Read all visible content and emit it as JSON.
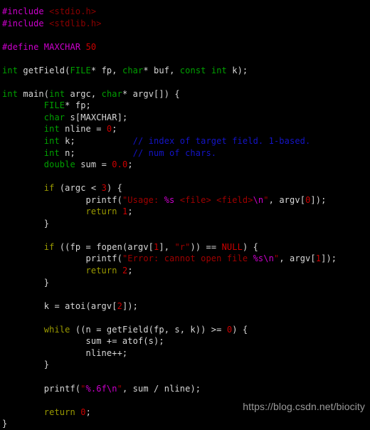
{
  "editor": {
    "background_color": "#000000",
    "language": "C",
    "colors": {
      "plain": "#d8d8d8",
      "keyword_type": "#00a000",
      "keyword_control": "#9a9a00",
      "preprocessor": "#cc00cc",
      "include_header": "#8b0000",
      "string": "#a00000",
      "format_specifier": "#cc00cc",
      "number": "#cc0000",
      "constant": "#cc0000",
      "comment": "#1414c8"
    }
  },
  "code": {
    "lines": [
      {
        "id": "line-1",
        "text": "#include <stdio.h>"
      },
      {
        "id": "line-2",
        "text": "#include <stdlib.h>"
      },
      {
        "id": "line-3",
        "text": ""
      },
      {
        "id": "line-4",
        "text": "#define MAXCHAR 50"
      },
      {
        "id": "line-5",
        "text": ""
      },
      {
        "id": "line-6",
        "text": "int getField(FILE* fp, char* buf, const int k);"
      },
      {
        "id": "line-7",
        "text": ""
      },
      {
        "id": "line-8",
        "text": "int main(int argc, char* argv[]) {"
      },
      {
        "id": "line-9",
        "text": "        FILE* fp;"
      },
      {
        "id": "line-10",
        "text": "        char s[MAXCHAR];"
      },
      {
        "id": "line-11",
        "text": "        int nline = 0;"
      },
      {
        "id": "line-12",
        "text": "        int k;           // index of target field. 1-based."
      },
      {
        "id": "line-13",
        "text": "        int n;           // num of chars."
      },
      {
        "id": "line-14",
        "text": "        double sum = 0.0;"
      },
      {
        "id": "line-15",
        "text": ""
      },
      {
        "id": "line-16",
        "text": "        if (argc < 3) {"
      },
      {
        "id": "line-17",
        "text": "                printf(\"Usage: %s <file> <field>\\n\", argv[0]);"
      },
      {
        "id": "line-18",
        "text": "                return 1;"
      },
      {
        "id": "line-19",
        "text": "        }"
      },
      {
        "id": "line-20",
        "text": ""
      },
      {
        "id": "line-21",
        "text": "        if ((fp = fopen(argv[1], \"r\")) == NULL) {"
      },
      {
        "id": "line-22",
        "text": "                printf(\"Error: cannot open file %s\\n\", argv[1]);"
      },
      {
        "id": "line-23",
        "text": "                return 2;"
      },
      {
        "id": "line-24",
        "text": "        }"
      },
      {
        "id": "line-25",
        "text": ""
      },
      {
        "id": "line-26",
        "text": "        k = atoi(argv[2]);"
      },
      {
        "id": "line-27",
        "text": ""
      },
      {
        "id": "line-28",
        "text": "        while ((n = getField(fp, s, k)) >= 0) {"
      },
      {
        "id": "line-29",
        "text": "                sum += atof(s);"
      },
      {
        "id": "line-30",
        "text": "                nline++;"
      },
      {
        "id": "line-31",
        "text": "        }"
      },
      {
        "id": "line-32",
        "text": ""
      },
      {
        "id": "line-33",
        "text": "        printf(\"%.6f\\n\", sum / nline);"
      },
      {
        "id": "line-34",
        "text": ""
      },
      {
        "id": "line-35",
        "text": "        return 0;"
      },
      {
        "id": "line-36",
        "text": "}"
      }
    ],
    "tokens": [
      [
        {
          "c": "t-pre",
          "t": "#include"
        },
        {
          "c": "t-plain",
          "t": " "
        },
        {
          "c": "t-header",
          "t": "<stdio.h>"
        }
      ],
      [
        {
          "c": "t-pre",
          "t": "#include"
        },
        {
          "c": "t-plain",
          "t": " "
        },
        {
          "c": "t-header",
          "t": "<stdlib.h>"
        }
      ],
      [],
      [
        {
          "c": "t-pre",
          "t": "#define"
        },
        {
          "c": "t-plain",
          "t": " "
        },
        {
          "c": "t-pre",
          "t": "MAXCHAR"
        },
        {
          "c": "t-plain",
          "t": " "
        },
        {
          "c": "t-num",
          "t": "50"
        }
      ],
      [],
      [
        {
          "c": "t-kw",
          "t": "int"
        },
        {
          "c": "t-plain",
          "t": " getField("
        },
        {
          "c": "t-kw",
          "t": "FILE"
        },
        {
          "c": "t-plain",
          "t": "* fp, "
        },
        {
          "c": "t-kw",
          "t": "char"
        },
        {
          "c": "t-plain",
          "t": "* buf, "
        },
        {
          "c": "t-kw",
          "t": "const int"
        },
        {
          "c": "t-plain",
          "t": " k);"
        }
      ],
      [],
      [
        {
          "c": "t-kw",
          "t": "int"
        },
        {
          "c": "t-plain",
          "t": " main("
        },
        {
          "c": "t-kw",
          "t": "int"
        },
        {
          "c": "t-plain",
          "t": " argc, "
        },
        {
          "c": "t-kw",
          "t": "char"
        },
        {
          "c": "t-plain",
          "t": "* argv[]) {"
        }
      ],
      [
        {
          "c": "t-plain",
          "t": "        "
        },
        {
          "c": "t-kw",
          "t": "FILE"
        },
        {
          "c": "t-plain",
          "t": "* fp;"
        }
      ],
      [
        {
          "c": "t-plain",
          "t": "        "
        },
        {
          "c": "t-kw",
          "t": "char"
        },
        {
          "c": "t-plain",
          "t": " s[MAXCHAR];"
        }
      ],
      [
        {
          "c": "t-plain",
          "t": "        "
        },
        {
          "c": "t-kw",
          "t": "int"
        },
        {
          "c": "t-plain",
          "t": " nline = "
        },
        {
          "c": "t-num",
          "t": "0"
        },
        {
          "c": "t-plain",
          "t": ";"
        }
      ],
      [
        {
          "c": "t-plain",
          "t": "        "
        },
        {
          "c": "t-kw",
          "t": "int"
        },
        {
          "c": "t-plain",
          "t": " k;           "
        },
        {
          "c": "t-cmt",
          "t": "// index of target field. 1-based."
        }
      ],
      [
        {
          "c": "t-plain",
          "t": "        "
        },
        {
          "c": "t-kw",
          "t": "int"
        },
        {
          "c": "t-plain",
          "t": " n;           "
        },
        {
          "c": "t-cmt",
          "t": "// num of chars."
        }
      ],
      [
        {
          "c": "t-plain",
          "t": "        "
        },
        {
          "c": "t-kw",
          "t": "double"
        },
        {
          "c": "t-plain",
          "t": " sum = "
        },
        {
          "c": "t-num",
          "t": "0.0"
        },
        {
          "c": "t-plain",
          "t": ";"
        }
      ],
      [],
      [
        {
          "c": "t-plain",
          "t": "        "
        },
        {
          "c": "t-ctrl",
          "t": "if"
        },
        {
          "c": "t-plain",
          "t": " (argc < "
        },
        {
          "c": "t-num",
          "t": "3"
        },
        {
          "c": "t-plain",
          "t": ") {"
        }
      ],
      [
        {
          "c": "t-plain",
          "t": "                printf("
        },
        {
          "c": "t-str",
          "t": "\"Usage: "
        },
        {
          "c": "t-fmt",
          "t": "%s"
        },
        {
          "c": "t-str",
          "t": " <file> <field>"
        },
        {
          "c": "t-fmt",
          "t": "\\n"
        },
        {
          "c": "t-str",
          "t": "\""
        },
        {
          "c": "t-plain",
          "t": ", argv["
        },
        {
          "c": "t-num",
          "t": "0"
        },
        {
          "c": "t-plain",
          "t": "]);"
        }
      ],
      [
        {
          "c": "t-plain",
          "t": "                "
        },
        {
          "c": "t-ctrl",
          "t": "return"
        },
        {
          "c": "t-plain",
          "t": " "
        },
        {
          "c": "t-num",
          "t": "1"
        },
        {
          "c": "t-plain",
          "t": ";"
        }
      ],
      [
        {
          "c": "t-plain",
          "t": "        }"
        }
      ],
      [],
      [
        {
          "c": "t-plain",
          "t": "        "
        },
        {
          "c": "t-ctrl",
          "t": "if"
        },
        {
          "c": "t-plain",
          "t": " ((fp = fopen(argv["
        },
        {
          "c": "t-num",
          "t": "1"
        },
        {
          "c": "t-plain",
          "t": "], "
        },
        {
          "c": "t-str",
          "t": "\"r\""
        },
        {
          "c": "t-plain",
          "t": ")) == "
        },
        {
          "c": "t-const",
          "t": "NULL"
        },
        {
          "c": "t-plain",
          "t": ") {"
        }
      ],
      [
        {
          "c": "t-plain",
          "t": "                printf("
        },
        {
          "c": "t-str",
          "t": "\"Error: cannot open file "
        },
        {
          "c": "t-fmt",
          "t": "%s\\n"
        },
        {
          "c": "t-str",
          "t": "\""
        },
        {
          "c": "t-plain",
          "t": ", argv["
        },
        {
          "c": "t-num",
          "t": "1"
        },
        {
          "c": "t-plain",
          "t": "]);"
        }
      ],
      [
        {
          "c": "t-plain",
          "t": "                "
        },
        {
          "c": "t-ctrl",
          "t": "return"
        },
        {
          "c": "t-plain",
          "t": " "
        },
        {
          "c": "t-num",
          "t": "2"
        },
        {
          "c": "t-plain",
          "t": ";"
        }
      ],
      [
        {
          "c": "t-plain",
          "t": "        }"
        }
      ],
      [],
      [
        {
          "c": "t-plain",
          "t": "        k = atoi(argv["
        },
        {
          "c": "t-num",
          "t": "2"
        },
        {
          "c": "t-plain",
          "t": "]);"
        }
      ],
      [],
      [
        {
          "c": "t-plain",
          "t": "        "
        },
        {
          "c": "t-ctrl",
          "t": "while"
        },
        {
          "c": "t-plain",
          "t": " ((n = getField(fp, s, k)) >= "
        },
        {
          "c": "t-num",
          "t": "0"
        },
        {
          "c": "t-plain",
          "t": ") {"
        }
      ],
      [
        {
          "c": "t-plain",
          "t": "                sum += atof(s);"
        }
      ],
      [
        {
          "c": "t-plain",
          "t": "                nline++;"
        }
      ],
      [
        {
          "c": "t-plain",
          "t": "        }"
        }
      ],
      [],
      [
        {
          "c": "t-plain",
          "t": "        printf("
        },
        {
          "c": "t-str",
          "t": "\""
        },
        {
          "c": "t-fmt",
          "t": "%.6f\\n"
        },
        {
          "c": "t-str",
          "t": "\""
        },
        {
          "c": "t-plain",
          "t": ", sum / nline);"
        }
      ],
      [],
      [
        {
          "c": "t-plain",
          "t": "        "
        },
        {
          "c": "t-ctrl",
          "t": "return"
        },
        {
          "c": "t-plain",
          "t": " "
        },
        {
          "c": "t-num",
          "t": "0"
        },
        {
          "c": "t-plain",
          "t": ";"
        }
      ],
      [
        {
          "c": "t-plain",
          "t": "}"
        }
      ]
    ]
  },
  "watermark": {
    "text": "https://blog.csdn.net/biocity"
  }
}
